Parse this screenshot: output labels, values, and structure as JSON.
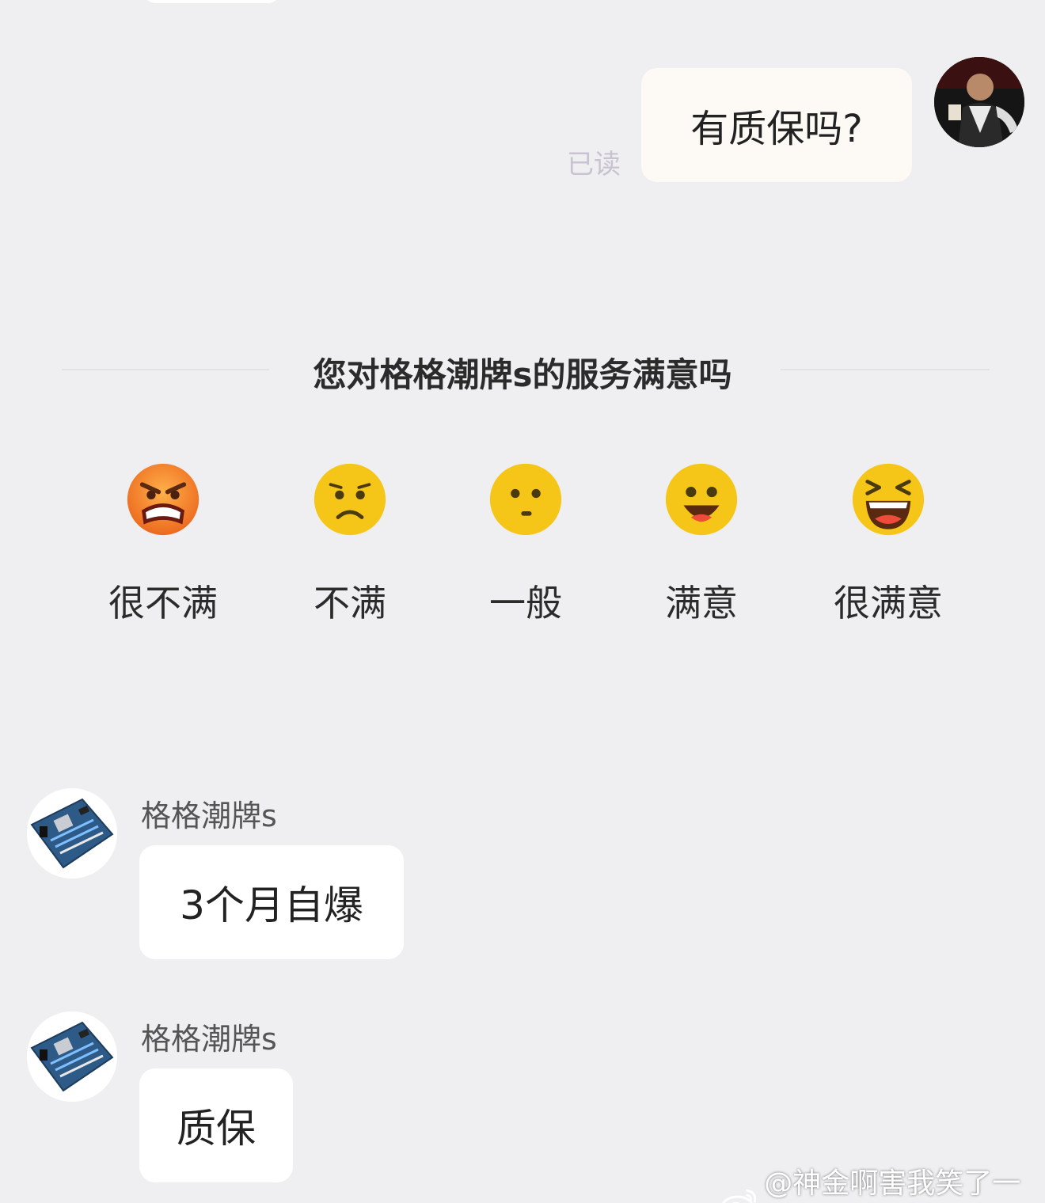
{
  "outgoing": {
    "text": "有质保吗?",
    "read_status": "已读"
  },
  "survey": {
    "title": "您对格格潮牌s的服务满意吗",
    "options": [
      {
        "label": "很不满",
        "icon": "furious-emoji-icon"
      },
      {
        "label": "不满",
        "icon": "frown-emoji-icon"
      },
      {
        "label": "一般",
        "icon": "neutral-emoji-icon"
      },
      {
        "label": "满意",
        "icon": "smile-emoji-icon"
      },
      {
        "label": "很满意",
        "icon": "laughing-emoji-icon"
      }
    ]
  },
  "incoming": [
    {
      "sender": "格格潮牌s",
      "text": "3个月自爆"
    },
    {
      "sender": "格格潮牌s",
      "text": "质保"
    }
  ],
  "watermark": {
    "text": "@神金啊害我笑了一下",
    "icon": "weibo-logo-icon"
  },
  "colors": {
    "background": "#efeff1",
    "outgoing_bubble": "#fdfaf5",
    "incoming_bubble": "#ffffff",
    "read_label": "#c9c3d1",
    "emoji_yellow": "#f5c518",
    "emoji_angry": "#f07a28"
  }
}
